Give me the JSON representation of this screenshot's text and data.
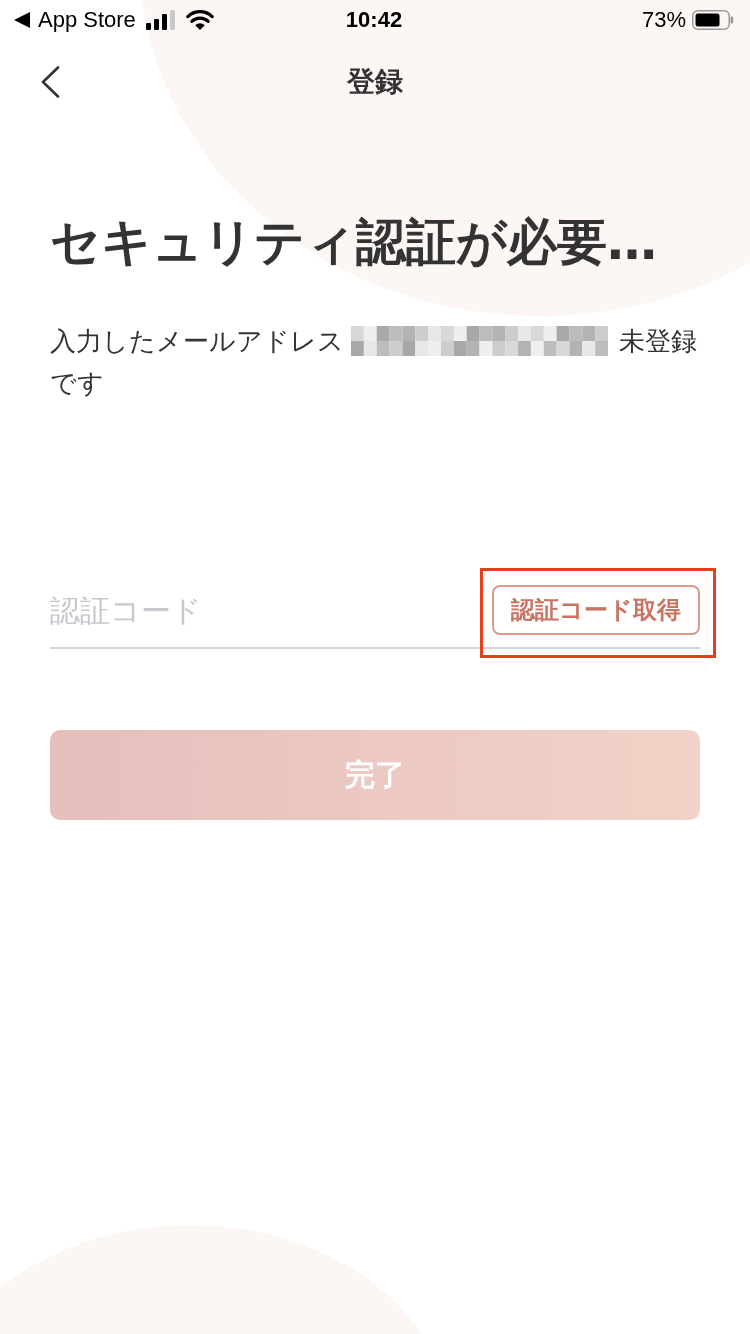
{
  "status_bar": {
    "back_app_label": "App Store",
    "time": "10:42",
    "battery": "73%"
  },
  "nav": {
    "title": "登録"
  },
  "heading": "セキュリティ認証が必要…",
  "message": [
    [
      {
        "kind": "text",
        "text": "入力したメールアドレス"
      },
      {
        "kind": "redacted"
      },
      {
        "kind": "text",
        "text": "未登録"
      }
    ],
    [
      {
        "kind": "text",
        "text": "です"
      }
    ]
  ],
  "code_field": {
    "placeholder": "認証コード"
  },
  "get_code_button": {
    "label": "認証コード取得",
    "highlighted": true
  },
  "done_button": {
    "label": "完了",
    "disabled": true
  }
}
